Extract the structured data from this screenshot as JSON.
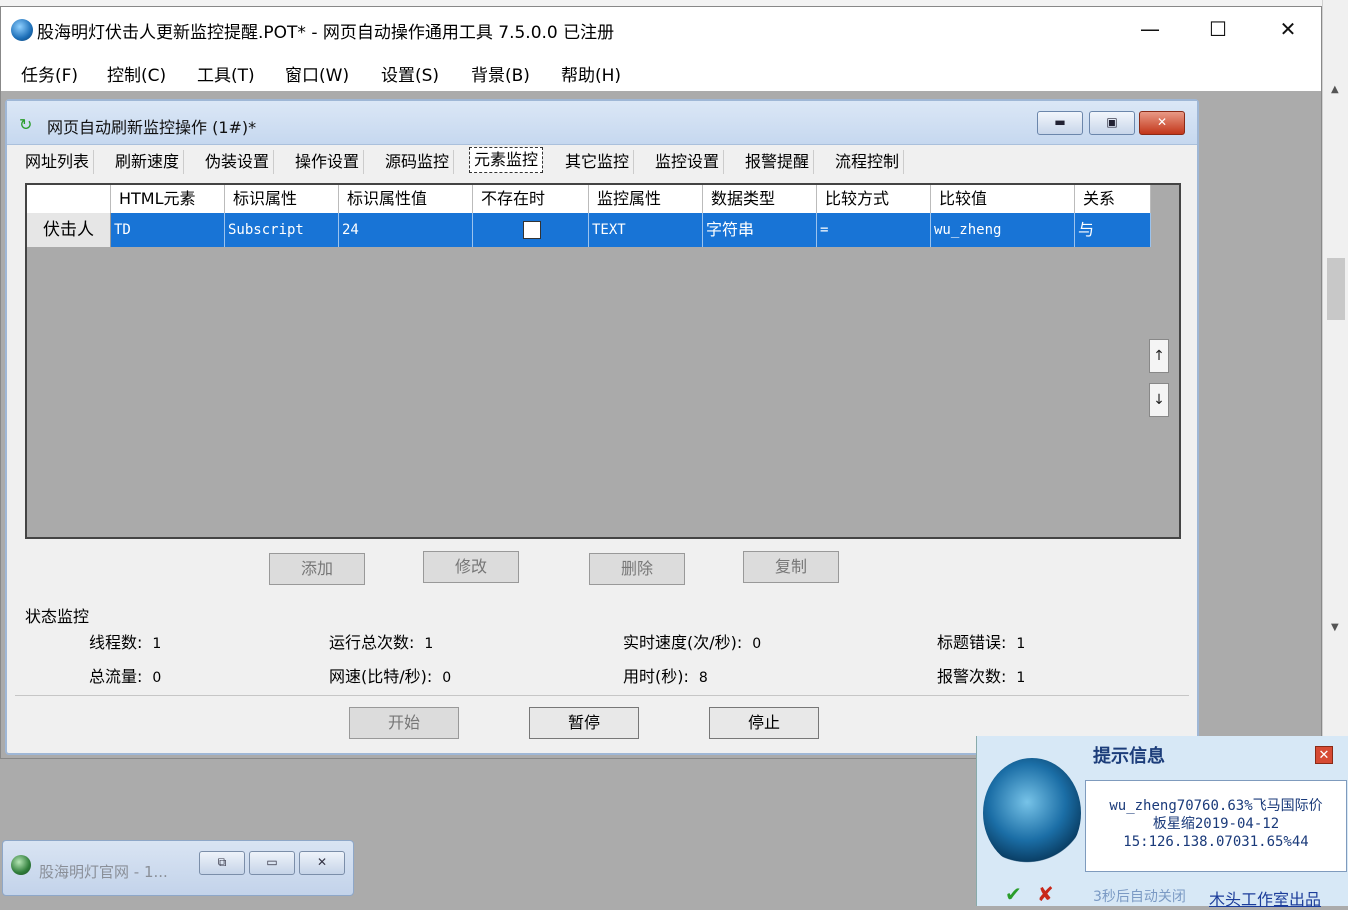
{
  "window": {
    "title": "股海明灯伏击人更新监控提醒.POT* - 网页自动操作通用工具 7.5.0.0  已注册",
    "min_label": "—",
    "max_label": "☐",
    "close_label": "✕"
  },
  "menu": [
    "任务(F)",
    "控制(C)",
    "工具(T)",
    "窗口(W)",
    "设置(S)",
    "背景(B)",
    "帮助(H)"
  ],
  "child": {
    "title": "网页自动刷新监控操作  (1#)*",
    "tabs": [
      "网址列表",
      "刷新速度",
      "伪装设置",
      "操作设置",
      "源码监控",
      "元素监控",
      "其它监控",
      "监控设置",
      "报警提醒",
      "流程控制"
    ],
    "active_tab": "元素监控",
    "grid": {
      "columns": [
        "HTML元素",
        "标识属性",
        "标识属性值",
        "不存在时",
        "监控属性",
        "数据类型",
        "比较方式",
        "比较值",
        "关系"
      ],
      "rows": [
        {
          "name": "伏击人",
          "html_element": "TD",
          "id_attr": "Subscript",
          "id_value": "24",
          "not_exist": false,
          "monitor_attr": "TEXT",
          "data_type": "字符串",
          "compare": "=",
          "compare_value": "wu_zheng",
          "relation": "与"
        }
      ]
    },
    "actions": {
      "add": "添加",
      "edit": "修改",
      "delete": "删除",
      "copy": "复制"
    },
    "status": {
      "title": "状态监控",
      "threads_label": "线程数:",
      "threads": "1",
      "total_runs_label": "运行总次数:",
      "total_runs": "1",
      "speed_label": "实时速度(次/秒):",
      "speed": "0",
      "title_errors_label": "标题错误:",
      "title_errors": "1",
      "traffic_label": "总流量:",
      "traffic": "0",
      "net_speed_label": "网速(比特/秒):",
      "net_speed": "0",
      "time_label": "用时(秒):",
      "time": "8",
      "alarms_label": "报警次数:",
      "alarms": "1"
    },
    "controls": {
      "start": "开始",
      "pause": "暂停",
      "stop": "停止"
    }
  },
  "minimized": {
    "title": "股海明灯官网 - 1..."
  },
  "popup": {
    "title": "提示信息",
    "body": "wu_zheng70760.63%飞马国际价\n板星缩2019-04-12\n15:126.138.07031.65%44",
    "auto_close": "3秒后自动关闭",
    "credit": "木头工作室出品"
  },
  "colors": {
    "selection": "#1874d6",
    "popup_bg": "#d7e8f6",
    "popup_title": "#1c3d7a"
  }
}
